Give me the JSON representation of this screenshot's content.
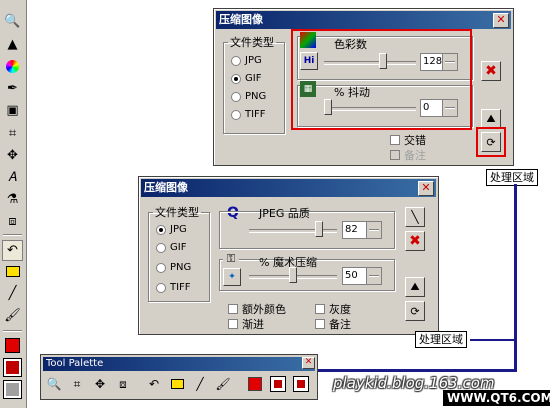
{
  "top_dialog": {
    "title": "压缩图像",
    "file_type_label": "文件类型",
    "file_types": [
      "JPG",
      "GIF",
      "PNG",
      "TIFF"
    ],
    "selected_file_type": "GIF",
    "colors_label": "色彩数",
    "colors_value": "128",
    "colors_slider_pct": 0.65,
    "dither_label": "% 抖动",
    "dither_value": "0",
    "dither_slider_pct": 0.0,
    "interlace_label": "交错",
    "comment_label": "备注"
  },
  "bottom_dialog": {
    "title": "压缩图像",
    "file_type_label": "文件类型",
    "file_types": [
      "JPG",
      "GIF",
      "PNG",
      "TIFF"
    ],
    "selected_file_type": "JPG",
    "quality_label": "JPEG 品质",
    "quality_value": "82",
    "quality_slider_pct": 0.82,
    "magic_label": "% 魔术压缩",
    "magic_value": "50",
    "magic_slider_pct": 0.5,
    "extra_color_label": "额外颜色",
    "grayscale_label": "灰度",
    "progressive_label": "渐进",
    "comment_label": "备注"
  },
  "callouts": {
    "top": "处理区域",
    "bottom": "处理区域"
  },
  "palette": {
    "title": "Tool Palette"
  },
  "watermark": {
    "site1": "playkid.blog.163.com",
    "site2": "WWW.QT6.COM"
  },
  "colors": {
    "highlight": "#e00000",
    "title_bar": "#0a246a",
    "connector": "#1a1a8c"
  }
}
